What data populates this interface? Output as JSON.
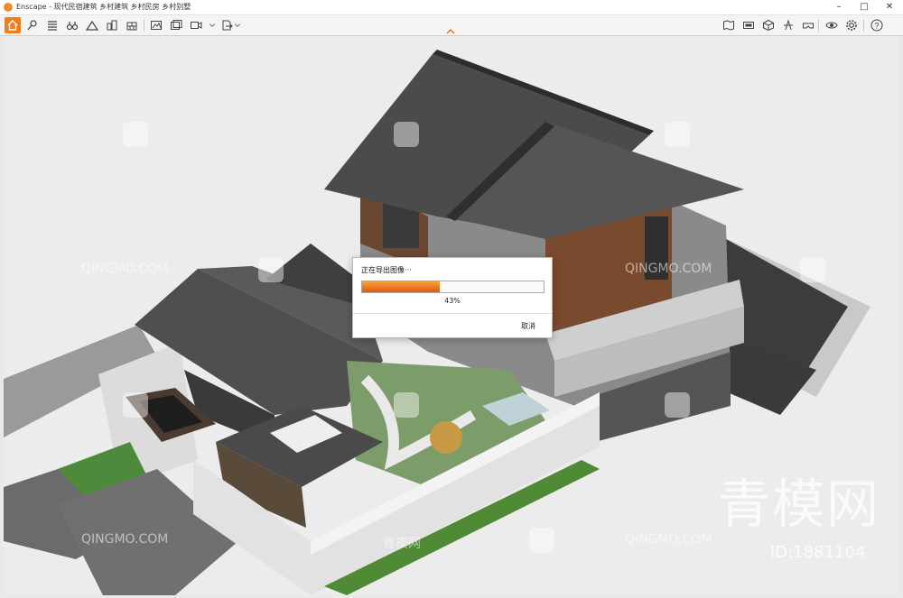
{
  "window": {
    "title": "Enscape - 现代民宿建筑 乡村建筑 乡村民房 乡村别墅",
    "controls": [
      "minimize",
      "maximize",
      "close"
    ]
  },
  "toolbar": {
    "left_icons": [
      "home-icon",
      "pin-icon",
      "list-icon",
      "binoculars-icon",
      "landscape-icon",
      "buildings-icon",
      "wall-icon",
      "render-image-icon",
      "render-batch-icon",
      "video-icon",
      "export-icon"
    ],
    "right_icons": [
      "map-icon",
      "panorama-icon",
      "cube-icon",
      "light-icon",
      "vr-icon",
      "settings-eye-icon",
      "gear-icon",
      "help-icon"
    ],
    "help_label": "?"
  },
  "export_dialog": {
    "title": "正在导出图像···",
    "progress_percent": 43,
    "progress_label": "43%",
    "cancel_label": "取消"
  },
  "watermarks": {
    "text": "QINGMO.COM",
    "brand": "青模网",
    "brand_large": "青模网",
    "id_label": "ID:1881104"
  },
  "colors": {
    "accent": "#f07c1c",
    "progress_start": "#f7a23e",
    "progress_end": "#e05a10"
  }
}
